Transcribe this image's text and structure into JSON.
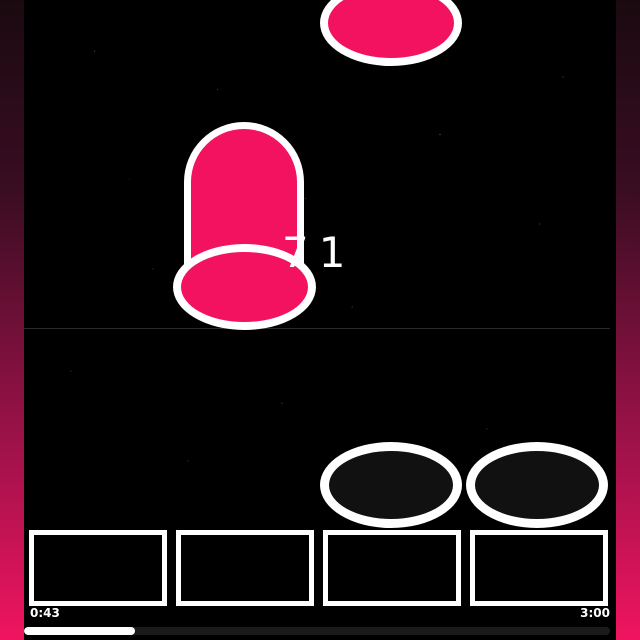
{
  "game": {
    "combo": "71",
    "lanes": 4,
    "note_color": "#f2125f",
    "side_gradient": [
      "#1a0a10",
      "#f0145f"
    ]
  },
  "notes": [
    {
      "lane": 3,
      "type": "tap",
      "state": "falling"
    },
    {
      "lane": 2,
      "type": "hold",
      "state": "falling"
    }
  ],
  "hit_targets": [
    {
      "lane": 3,
      "state": "empty"
    },
    {
      "lane": 4,
      "state": "empty"
    }
  ],
  "progress": {
    "elapsed": "0:43",
    "total": "3:00",
    "fraction": 0.19
  }
}
